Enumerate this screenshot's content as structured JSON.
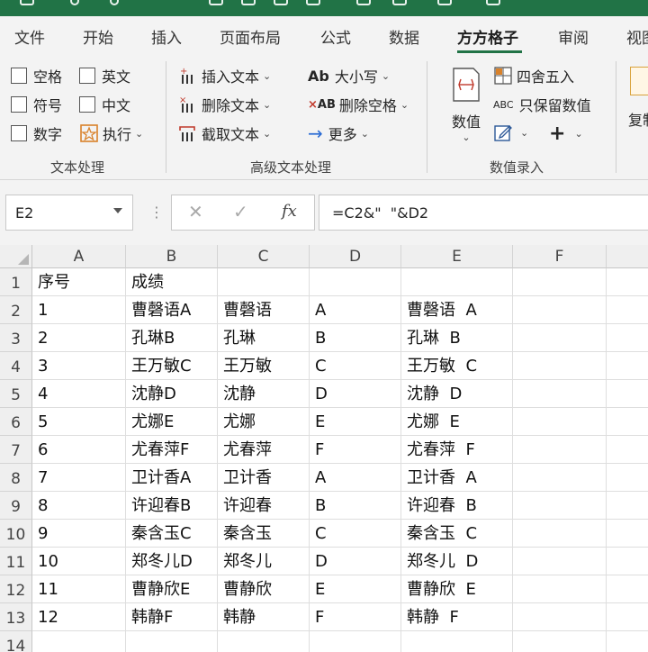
{
  "ribbon_tabs": [
    {
      "label": "文件"
    },
    {
      "label": "开始"
    },
    {
      "label": "插入"
    },
    {
      "label": "页面布局"
    },
    {
      "label": "公式"
    },
    {
      "label": "数据"
    },
    {
      "label": "方方格子",
      "active": true
    },
    {
      "label": "审阅"
    },
    {
      "label": "视图"
    }
  ],
  "groups": {
    "text": {
      "label": "文本处理",
      "checkboxes": [
        "空格",
        "英文",
        "符号",
        "中文",
        "数字"
      ],
      "execute": "执行"
    },
    "advanced": {
      "label": "高级文本处理",
      "buttons": [
        "插入文本",
        "删除文本",
        "截取文本",
        "大小写",
        "删除空格",
        "更多"
      ],
      "icon_texts": {
        "case": "Ab",
        "trim": "AB"
      }
    },
    "numeric": {
      "label": "数值录入",
      "value_button": "数值",
      "round": "四舍五入",
      "keep_value": "只保留数值",
      "keep_value_icon": "ABC",
      "partial": "复制"
    }
  },
  "colors": {
    "accent": "#217346",
    "ribbon_bg": "#f3f3f3"
  },
  "formula_bar": {
    "name_box": "E2",
    "fx": "fx",
    "formula": "=C2&\"  \"&D2"
  },
  "columns": [
    "A",
    "B",
    "C",
    "D",
    "E",
    "F"
  ],
  "rows": [
    {
      "n": "1",
      "a": "序号",
      "b": "成绩",
      "c": "",
      "d": "",
      "e": ""
    },
    {
      "n": "2",
      "a": "1",
      "b": "曹磬语A",
      "c": "曹磬语",
      "d": "A",
      "e": "曹磬语  A"
    },
    {
      "n": "3",
      "a": "2",
      "b": "孔琳B",
      "c": "孔琳",
      "d": "B",
      "e": "孔琳  B"
    },
    {
      "n": "4",
      "a": "3",
      "b": "王万敏C",
      "c": "王万敏",
      "d": "C",
      "e": "王万敏  C"
    },
    {
      "n": "5",
      "a": "4",
      "b": "沈静D",
      "c": "沈静",
      "d": "D",
      "e": "沈静  D"
    },
    {
      "n": "6",
      "a": "5",
      "b": "尤娜E",
      "c": "尤娜",
      "d": "E",
      "e": "尤娜  E"
    },
    {
      "n": "7",
      "a": "6",
      "b": "尤春萍F",
      "c": "尤春萍",
      "d": "F",
      "e": "尤春萍  F"
    },
    {
      "n": "8",
      "a": "7",
      "b": "卫计香A",
      "c": "卫计香",
      "d": "A",
      "e": "卫计香  A"
    },
    {
      "n": "9",
      "a": "8",
      "b": "许迎春B",
      "c": "许迎春",
      "d": "B",
      "e": "许迎春  B"
    },
    {
      "n": "10",
      "a": "9",
      "b": "秦含玉C",
      "c": "秦含玉",
      "d": "C",
      "e": "秦含玉  C"
    },
    {
      "n": "11",
      "a": "10",
      "b": "郑冬儿D",
      "c": "郑冬儿",
      "d": "D",
      "e": "郑冬儿  D"
    },
    {
      "n": "12",
      "a": "11",
      "b": "曹静欣E",
      "c": "曹静欣",
      "d": "E",
      "e": "曹静欣  E"
    },
    {
      "n": "13",
      "a": "12",
      "b": "韩静F",
      "c": "韩静",
      "d": "F",
      "e": "韩静  F"
    },
    {
      "n": "14",
      "a": "",
      "b": "",
      "c": "",
      "d": "",
      "e": ""
    }
  ]
}
